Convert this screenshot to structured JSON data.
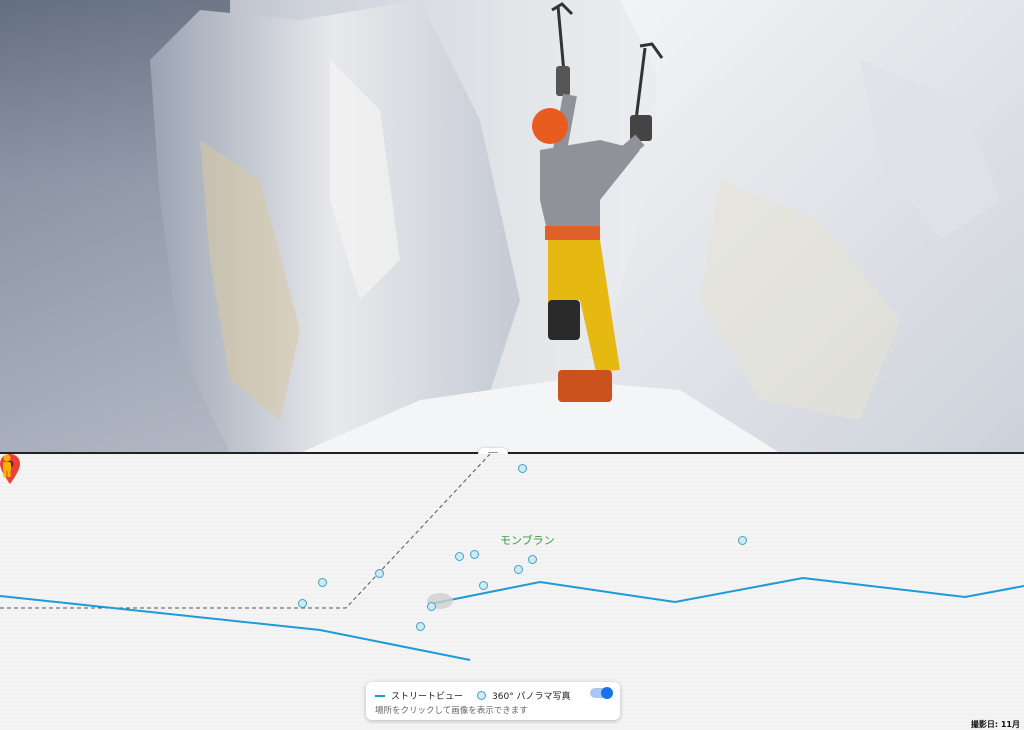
{
  "map": {
    "place_label": "モンブラン",
    "capture_date": "撮影日: 11月"
  },
  "legend": {
    "street_view_label": "ストリートビュー",
    "panorama_label": "360° パノラマ写真",
    "hint": "場所をクリックして画像を表示できます",
    "panorama_toggle_on": true
  },
  "colors": {
    "street_view_line": "#1e9bd6",
    "panorama_dot_fill": "#cfe9f5",
    "panorama_dot_border": "#3fa3c9",
    "pin": "#ea4335",
    "pegman": "#f4b400"
  },
  "icons": [
    "map-pin-icon",
    "pegman-icon",
    "drag-handle-icon",
    "toggle-switch"
  ]
}
